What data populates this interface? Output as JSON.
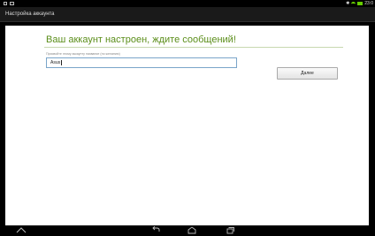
{
  "status_bar": {
    "time": "23:0",
    "battery_color": "#66cc00"
  },
  "title_bar": {
    "title": "Настройка аккаунта"
  },
  "main": {
    "heading": "Ваш аккаунт настроен, ждите сообщений!",
    "name_label": "Присвойте этому аккаунту название (по желанию)",
    "name_value": "Asus",
    "next_button": "Далее"
  },
  "nav_bar": {
    "icons": [
      "apps-icon",
      "back-icon",
      "home-icon",
      "recents-icon"
    ]
  }
}
